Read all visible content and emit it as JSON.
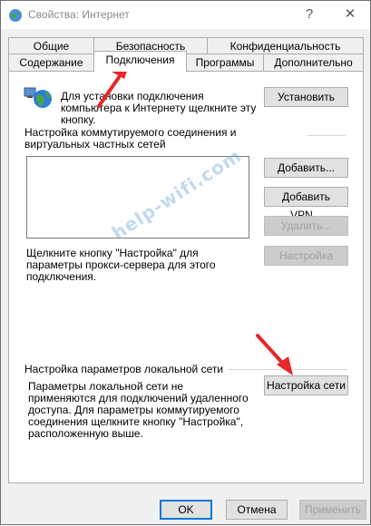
{
  "window": {
    "title": "Свойства: Интернет",
    "help_label": "?",
    "close_label": "✕"
  },
  "tabs": [
    {
      "label": "Общие"
    },
    {
      "label": "Безопасность"
    },
    {
      "label": "Конфиденциальность"
    },
    {
      "label": "Содержание"
    },
    {
      "label": "Подключения",
      "active": true
    },
    {
      "label": "Программы"
    },
    {
      "label": "Дополнительно"
    }
  ],
  "setup": {
    "text": "Для установки подключения компьютера к Интернету щелкните эту кнопку.",
    "button": "Установить"
  },
  "dialup": {
    "heading": "Настройка коммутируемого соединения и виртуальных частных сетей",
    "add_button": "Добавить...",
    "add_vpn_button": "Добавить VPN...",
    "remove_button": "Удалить...",
    "settings_hint": "Щелкните кнопку \"Настройка\" для параметры прокси-сервера для этого подключения.",
    "settings_button": "Настройка"
  },
  "lan": {
    "heading": "Настройка параметров локальной сети",
    "description": "Параметры локальной сети не применяются для подключений удаленного доступа. Для параметры коммутируемого соединения щелкните кнопку \"Настройка\", расположенную выше.",
    "button": "Настройка сети"
  },
  "footer": {
    "ok": "OK",
    "cancel": "Отмена",
    "apply": "Применить"
  },
  "watermark": "help-wifi.com",
  "colors": {
    "arrow": "#e8262b",
    "accent": "#0078d7"
  }
}
